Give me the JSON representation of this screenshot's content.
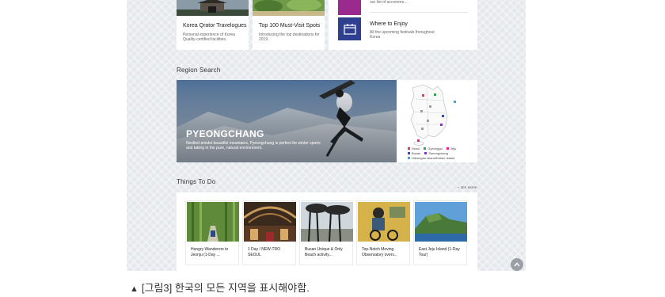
{
  "cards": [
    {
      "title": "Korea Qrator Travelogues",
      "desc": "Personal experience of Korea Quality-certified facilities."
    },
    {
      "title": "Top 100 Must-Visit Spots",
      "desc": "Introducing the top destinations for 2019."
    }
  ],
  "promos": [
    {
      "desc_partial": "our list of accommo..."
    },
    {
      "title": "Where to Enjoy",
      "desc": "All the upcoming festivals throughout Korea"
    }
  ],
  "region_search": {
    "heading": "Region Search",
    "banner_title": "PYEONGCHANG",
    "banner_desc": "Nestled amidst beautiful mountains, Pyeongchang is perfect for winter sports and taking in the pure, natural environment.",
    "legend": [
      {
        "label": "Seoul",
        "color": "#e8354a"
      },
      {
        "label": "Gyeonggu",
        "color": "#2fa84f"
      },
      {
        "label": "Jeju",
        "color": "#e91e8c"
      },
      {
        "label": "Busan",
        "color": "#3a4aa8"
      },
      {
        "label": "Pyeongchang",
        "color": "#7a3dbf"
      },
      {
        "label": "Ulleungdo Island/Dokdo Island",
        "color": "#39a8e0"
      }
    ]
  },
  "things_to_do": {
    "heading": "Things To Do",
    "see_more": "SEE MORE",
    "items": [
      {
        "label": "Hungry Wanderers to Jeonju (1-Day ..."
      },
      {
        "label": "1 Day / NEW-TRO SEOUL"
      },
      {
        "label": "Busan Unique & Only Beach activity..."
      },
      {
        "label": "Top-Notch Moving Observatory overv..."
      },
      {
        "label": "East Jeju Island (1-Day Tour)"
      }
    ]
  },
  "caption": {
    "marker": "▲",
    "text": "[그림3] 한국의 모든 지역을 표시해야함."
  },
  "icons": {
    "calendar": "calendar-icon",
    "scroll_top": "chevron-up-icon"
  }
}
